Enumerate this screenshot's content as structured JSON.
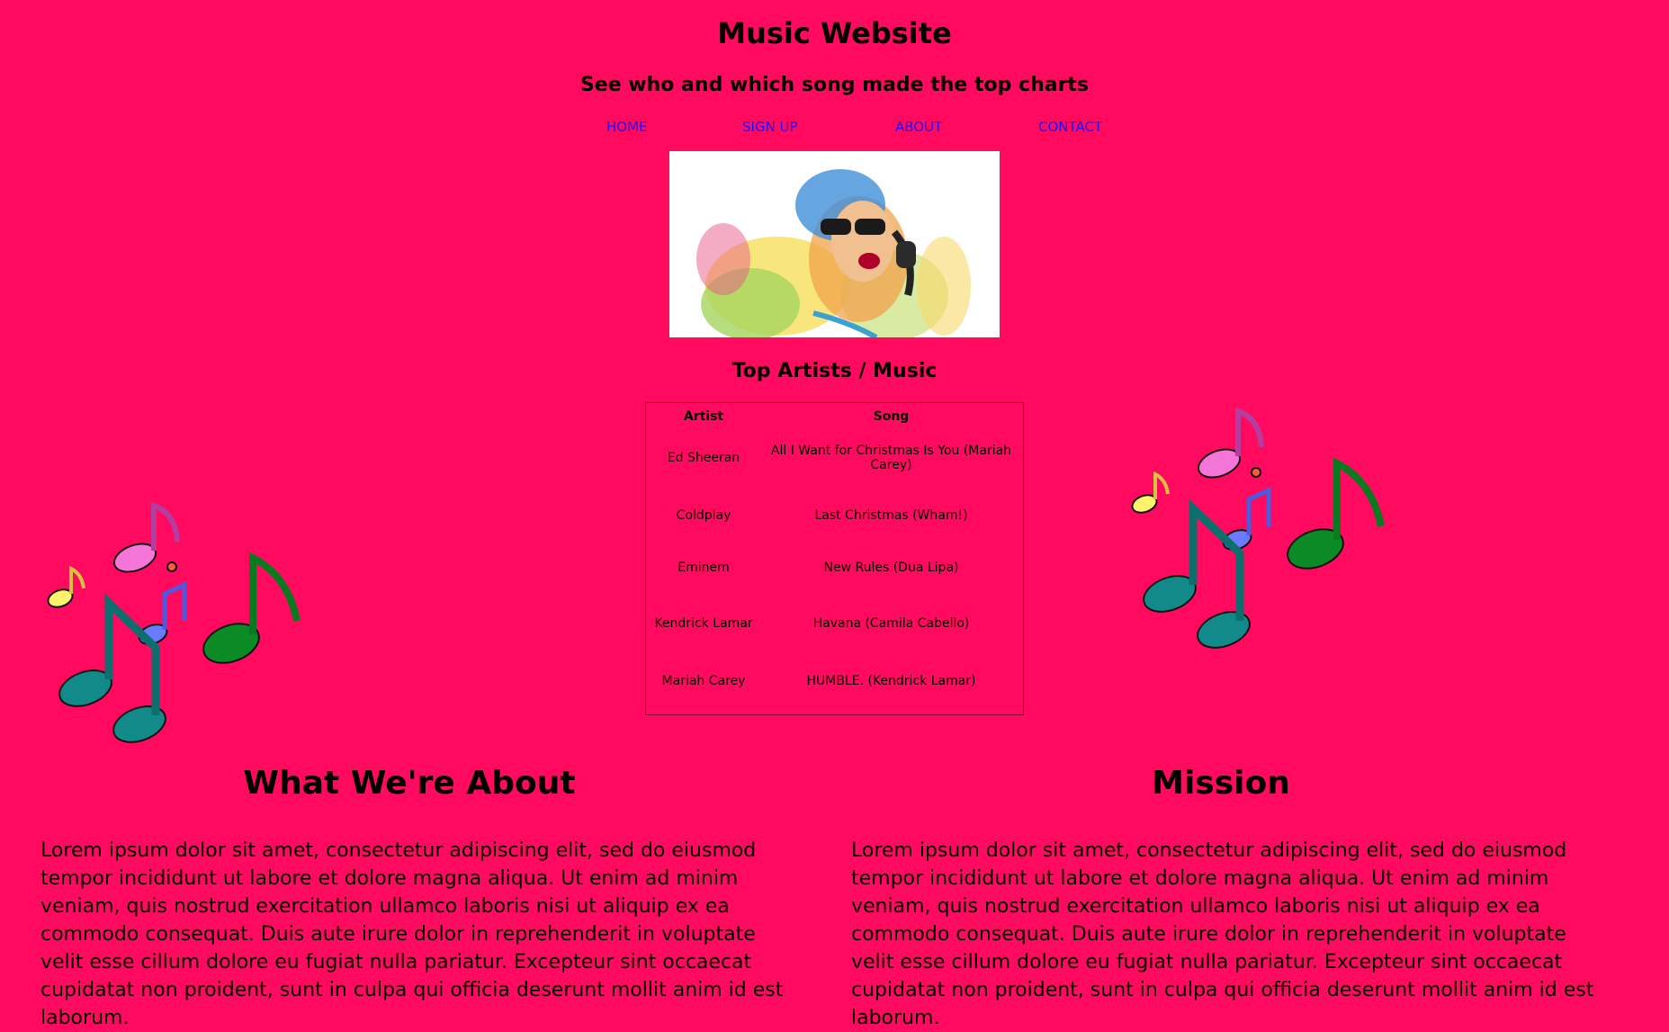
{
  "header": {
    "title": "Music Website",
    "subtitle": "See who and which song made the top charts"
  },
  "nav": {
    "home": "HOME",
    "signup": "SIGN UP",
    "about": "ABOUT",
    "contact": "CONTACT"
  },
  "hero": {
    "icon": "dj-with-headphones-illustration"
  },
  "top": {
    "heading": "Top Artists / Music",
    "columns": [
      "Artist",
      "Song"
    ],
    "rows": [
      [
        "Ed Sheeran",
        "All I Want for Christmas Is You (Mariah Carey)"
      ],
      [
        "Coldplay",
        "Last Christmas (Wham!)"
      ],
      [
        "Eminem",
        "New Rules (Dua Lipa)"
      ],
      [
        "Kendrick Lamar",
        "Havana (Camila Cabello)"
      ],
      [
        "Mariah Carey",
        "HUMBLE. (Kendrick Lamar)"
      ]
    ]
  },
  "about": {
    "title": "What We're About",
    "body": "Lorem ipsum dolor sit amet, consectetur adipiscing elit, sed do eiusmod tempor incididunt ut labore et dolore magna aliqua. Ut enim ad minim veniam, quis nostrud exercitation ullamco laboris nisi ut aliquip ex ea commodo consequat. Duis aute irure dolor in reprehenderit in voluptate velit esse cillum dolore eu fugiat nulla pariatur. Excepteur sint occaecat cupidatat non proident, sunt in culpa qui officia deserunt mollit anim id est laborum."
  },
  "mission": {
    "title": "Mission",
    "body": "Lorem ipsum dolor sit amet, consectetur adipiscing elit, sed do eiusmod tempor incididunt ut labore et dolore magna aliqua. Ut enim ad minim veniam, quis nostrud exercitation ullamco laboris nisi ut aliquip ex ea commodo consequat. Duis aute irure dolor in reprehenderit in voluptate velit esse cillum dolore eu fugiat nulla pariatur. Excepteur sint occaecat cupidatat non proident, sunt in culpa qui officia deserunt mollit anim id est laborum."
  },
  "colors": {
    "background": "#ff0a5e",
    "link": "#1d0cff"
  }
}
